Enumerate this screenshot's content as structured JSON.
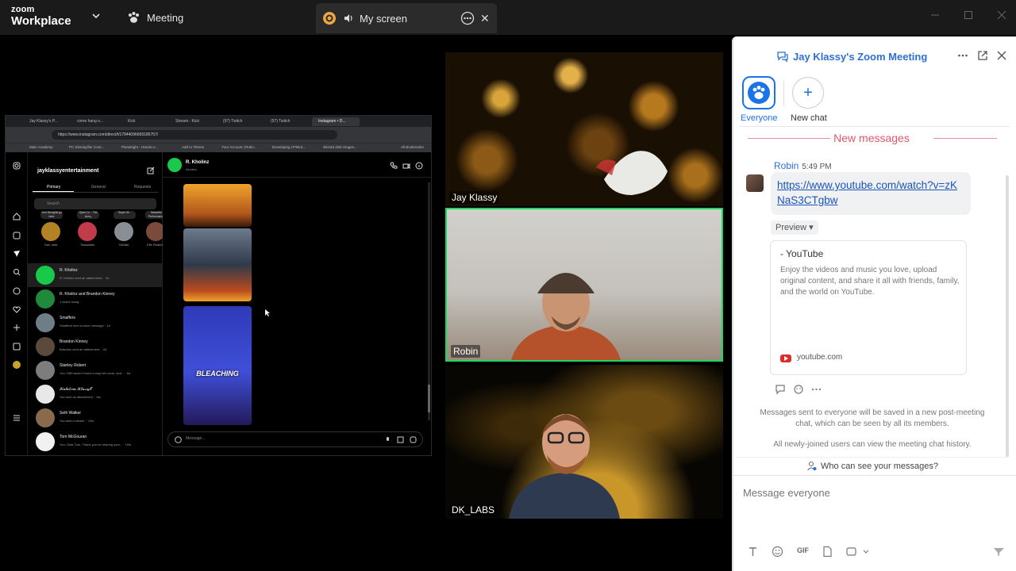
{
  "topbar": {
    "logo_line1": "zoom",
    "logo_line2": "Workplace",
    "meeting_label": "Meeting",
    "screen_tab_label": "My screen"
  },
  "shared_screen": {
    "browser_tabs": [
      "Jay Klassy's P...",
      "come hang o...",
      "Kick",
      "Stream - Kick",
      "(97) Twitch",
      "(97) Twitch",
      "Instagram • D..."
    ],
    "url": "https://www.instagram.com/direct/t/17844096669186757/",
    "bookmarks": [
      "Main Academy",
      "PC Dismayifier Com...",
      "Pluralsight - Hands-o...",
      "Add to Theme",
      "Your Account | Robo...",
      "Developing HTML5...",
      "Wizard disk images...",
      "All Bookmarks"
    ],
    "account": "jayklassyentertainment",
    "tabs": [
      "Primary",
      "General",
      "Requests"
    ],
    "search_placeholder": "Search",
    "notes": [
      {
        "label": "Your note",
        "bubble": "Your thoughts go here"
      },
      {
        "label": "Twosades",
        "bubble": "Open Lo... The Army"
      },
      {
        "label": "YoDate",
        "bubble": "Super W..."
      },
      {
        "label": "Elle Rodene",
        "bubble": "Beautiful Performance"
      }
    ],
    "conversations": [
      {
        "name": "R. Kholinz",
        "sub": "R. Kholinz sent an attachment. · 1h"
      },
      {
        "name": "R. Kholinz and Brandon Kinney",
        "sub": "1 active today"
      },
      {
        "name": "Smaffers",
        "sub": "Smaffers sent a voice message · 1d"
      },
      {
        "name": "Brandon Kinney",
        "sub": "Brandon sent an attachment. · 2d"
      },
      {
        "name": "Stanley Robert",
        "sub": "You: Still haven't found a way into work, and... · 6d"
      },
      {
        "name": "𝒦𝒶𝓉𝒶𝓁𝒾𝓃𝒶 𝒦𝓁𝒶𝓈𝓈𝓎𝒪",
        "sub": "You sent an attachment. · 8w"
      },
      {
        "name": "Seth Walker",
        "sub": "You sent a sticker. · 19w"
      },
      {
        "name": "Tom McGouran",
        "sub": "You: Dear Tom, Thank you for sharing your... · 19w"
      }
    ],
    "chat_name": "R. Kholinz",
    "chat_sub": "rkholinz",
    "post_text": "BLEACHING",
    "message_placeholder": "Message..."
  },
  "videos": [
    {
      "name": "Jay Klassy"
    },
    {
      "name": "Robin"
    },
    {
      "name": "DK_LABS"
    }
  ],
  "chat": {
    "title": "Jay Klassy's Zoom Meeting",
    "everyone_label": "Everyone",
    "new_chat_label": "New chat",
    "new_messages": "New messages",
    "sender": "Robin",
    "time": "5:49 PM",
    "link": "https://www.youtube.com/watch?v=zKNaS3CTgbw",
    "preview_label": "Preview",
    "card_title": "- YouTube",
    "card_desc": "Enjoy the videos and music you love, upload original content, and share it all with friends, family, and the world on YouTube.",
    "card_url": "youtube.com",
    "info1": "Messages sent to everyone will be saved in a new post-meeting chat, which can be seen by all its members.",
    "info2": "All newly-joined users can view the meeting chat history.",
    "who_can_see": "Who can see your messages?",
    "input_placeholder": "Message everyone",
    "gif_label": "GIF"
  },
  "colors": {
    "zoom_blue": "#1a73e8",
    "new_messages": "#e0566a",
    "active_speaker_border": "#1ed760",
    "youtube_red": "#e02b2b"
  }
}
